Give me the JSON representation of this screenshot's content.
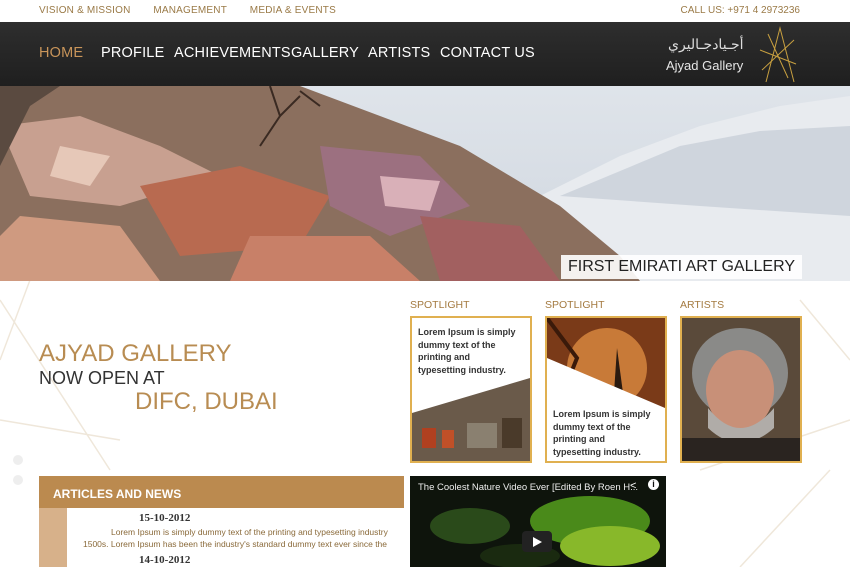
{
  "top_links": [
    "VISION & MISSION",
    "MANAGEMENT",
    "MEDIA & EVENTS"
  ],
  "call": "CALL US: +971 4 2973236",
  "nav": {
    "items": [
      "HOME",
      "PROFILE",
      "ACHIEVEMENTS",
      "GALLERY",
      "ARTISTS",
      "CONTACT US"
    ],
    "active": "HOME"
  },
  "logo": {
    "arabic": "أجـيادجـاليري",
    "name": "Ajyad Gallery"
  },
  "hero": {
    "caption": "FIRST EMIRATI ART GALLERY"
  },
  "tagline": {
    "line1": "AJYAD GALLERY",
    "line2": "NOW OPEN AT",
    "line3": "DIFC, DUBAI"
  },
  "cards": [
    {
      "label": "SPOTLIGHT",
      "text": "Lorem Ipsum is simply dummy text of the printing and typesetting industry."
    },
    {
      "label": "SPOTLIGHT",
      "text": "Lorem Ipsum is simply dummy text of the printing and typesetting industry."
    },
    {
      "label": "ARTISTS",
      "text": ""
    }
  ],
  "articles": {
    "title": "ARTICLES AND NEWS",
    "items": [
      {
        "date": "15-10-2012",
        "line1": "Lorem Ipsum is simply dummy text of the printing and typesetting industry",
        "line2": "1500s. Lorem Ipsum has been the industry's standard dummy text ever since the"
      },
      {
        "date": "14-10-2012"
      }
    ]
  },
  "video": {
    "title": "The Coolest Nature Video Ever [Edited By Roen H..."
  },
  "colors": {
    "accent": "#b88c52",
    "nav_bg": "#262626",
    "card_border": "#e0b050",
    "articles_bg": "#bb8a4f"
  }
}
